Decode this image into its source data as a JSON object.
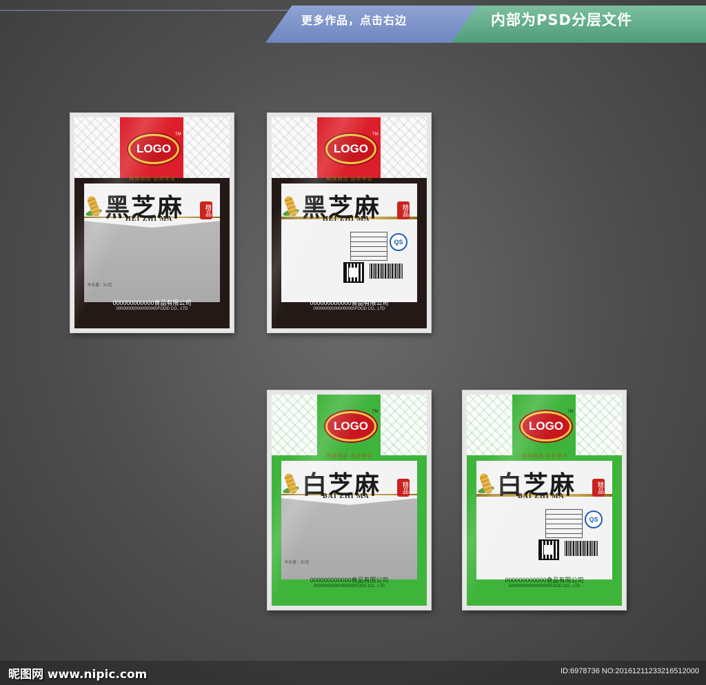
{
  "banner": {
    "left_text": "更多作品，点击右边",
    "right_text": "内部为PSD分层文件"
  },
  "packages": [
    {
      "variant": "black",
      "logo": "LOGO",
      "tm": "TM",
      "slogan": "精挑细选 品质保证",
      "title": "黑芝麻",
      "pinyin": "HEI ZHI MA",
      "seal": "精品",
      "net_weight": "净含量：50克",
      "company_cn": "000000000000食品有限公司",
      "company_en": "000000000000000000FOOD CO., LTD"
    },
    {
      "variant": "black",
      "logo": "LOGO",
      "tm": "TM",
      "slogan": "精挑细选 品质保证",
      "title": "黑芝麻",
      "pinyin": "HEI ZHI MA",
      "seal": "精品",
      "qs": "QS",
      "company_cn": "000000000000食品有限公司",
      "company_en": "000000000000000000FOOD CO., LTD"
    },
    {
      "variant": "green",
      "logo": "LOGO",
      "tm": "TM",
      "slogan": "精挑细选 品质保证",
      "title": "白芝麻",
      "pinyin": "BAI ZHI MA",
      "seal": "精品",
      "net_weight": "净含量：50克",
      "company_cn": "000000000000食品有限公司",
      "company_en": "000000000000000000FOOD CO., LTD"
    },
    {
      "variant": "green",
      "logo": "LOGO",
      "tm": "TM",
      "slogan": "精挑细选 品质保证",
      "title": "白芝麻",
      "pinyin": "BAI ZHI MA",
      "seal": "精品",
      "qs": "QS",
      "company_cn": "000000000000食品有限公司",
      "company_en": "000000000000000000FOOD CO., LTD"
    }
  ],
  "footer": {
    "site": "昵图网 www.nipic.com",
    "id": "ID:6978736 NO:20161211233216512000"
  }
}
